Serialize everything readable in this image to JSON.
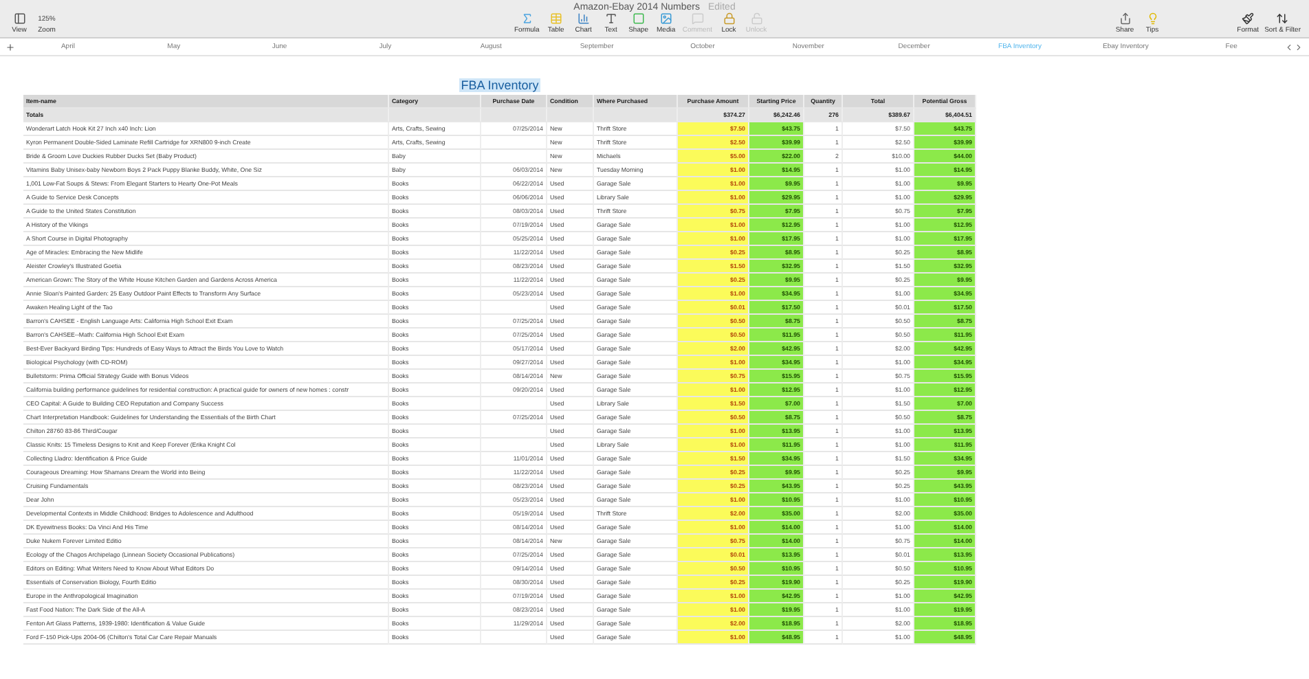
{
  "window": {
    "title": "Amazon-Ebay 2014 Numbers",
    "status": "Edited"
  },
  "toolbar": {
    "left": [
      {
        "label": "View",
        "kind": "view"
      },
      {
        "label": "Zoom",
        "kind": "zoom",
        "value": "125%"
      }
    ],
    "center": [
      {
        "label": "Formula",
        "kind": "formula",
        "disabled": false
      },
      {
        "label": "Table",
        "kind": "table",
        "disabled": false
      },
      {
        "label": "Chart",
        "kind": "chart",
        "disabled": false
      },
      {
        "label": "Text",
        "kind": "text",
        "disabled": false
      },
      {
        "label": "Shape",
        "kind": "shape",
        "disabled": false
      },
      {
        "label": "Media",
        "kind": "media",
        "disabled": false
      },
      {
        "label": "Comment",
        "kind": "comment",
        "disabled": true
      },
      {
        "label": "Lock",
        "kind": "lock",
        "disabled": false
      },
      {
        "label": "Unlock",
        "kind": "unlock",
        "disabled": true
      }
    ],
    "right": [
      {
        "label": "Share",
        "kind": "share",
        "disabled": false
      },
      {
        "label": "Tips",
        "kind": "tips",
        "disabled": false
      }
    ],
    "far_right": [
      {
        "label": "Format",
        "kind": "format",
        "disabled": false
      },
      {
        "label": "Sort & Filter",
        "kind": "sort",
        "disabled": false
      }
    ]
  },
  "sheet_tabs": [
    {
      "label": "April",
      "selected": false
    },
    {
      "label": "May",
      "selected": false
    },
    {
      "label": "June",
      "selected": false
    },
    {
      "label": "July",
      "selected": false
    },
    {
      "label": "August",
      "selected": false
    },
    {
      "label": "September",
      "selected": false
    },
    {
      "label": "October",
      "selected": false
    },
    {
      "label": "November",
      "selected": false
    },
    {
      "label": "December",
      "selected": false
    },
    {
      "label": "FBA Inventory",
      "selected": true
    },
    {
      "label": "Ebay Inventory",
      "selected": false
    },
    {
      "label": "Fee",
      "selected": false
    }
  ],
  "table": {
    "title": "FBA Inventory",
    "columns": [
      {
        "label": "Item-name",
        "kind": "text"
      },
      {
        "label": "Category",
        "kind": "text"
      },
      {
        "label": "Purchase Date",
        "kind": "date"
      },
      {
        "label": "Condition",
        "kind": "text"
      },
      {
        "label": "Where Purchased",
        "kind": "text"
      },
      {
        "label": "Purchase Amount",
        "kind": "cost"
      },
      {
        "label": "Starting Price",
        "kind": "price"
      },
      {
        "label": "Quantity",
        "kind": "number"
      },
      {
        "label": "Total",
        "kind": "number"
      },
      {
        "label": "Potential Gross",
        "kind": "price"
      }
    ],
    "totals": {
      "label": "Totals",
      "values": [
        "$374.27",
        "$6,242.46",
        "276",
        "$389.67",
        "$6,404.51"
      ]
    },
    "rows": [
      [
        "Wonderart Latch Hook Kit 27 Inch x40 Inch: Lion",
        "Arts, Crafts, Sewing",
        "07/25/2014",
        "New",
        "Thrift Store",
        "$7.50",
        "$43.75",
        "1",
        "$7.50",
        "$43.75"
      ],
      [
        "Kyron Permanent Double-Sided Laminate Refill Cartridge for XRN800 9-inch Create",
        "Arts, Crafts, Sewing",
        null,
        "New",
        "Thrift Store",
        "$2.50",
        "$39.99",
        "1",
        "$2.50",
        "$39.99"
      ],
      [
        "Bride & Groom Love Duckies Rubber Ducks Set (Baby Product)",
        "Baby",
        null,
        "New",
        "Michaels",
        "$5.00",
        "$22.00",
        "2",
        "$10.00",
        "$44.00"
      ],
      [
        "Vitamins Baby Unisex-baby Newborn Boys 2 Pack Puppy Blanke Buddy, White, One Siz",
        "Baby",
        "06/03/2014",
        "New",
        "Tuesday Morning",
        "$1.00",
        "$14.95",
        "1",
        "$1.00",
        "$14.95"
      ],
      [
        "1,001 Low-Fat Soups & Stews: From Elegant Starters to Hearty One-Pot Meals",
        "Books",
        "06/22/2014",
        "Used",
        "Garage Sale",
        "$1.00",
        "$9.95",
        "1",
        "$1.00",
        "$9.95"
      ],
      [
        "A Guide to Service Desk Concepts",
        "Books",
        "06/06/2014",
        "Used",
        "Library Sale",
        "$1.00",
        "$29.95",
        "1",
        "$1.00",
        "$29.95"
      ],
      [
        "A Guide to the United States Constitution",
        "Books",
        "08/03/2014",
        "Used",
        "Thrift Store",
        "$0.75",
        "$7.95",
        "1",
        "$0.75",
        "$7.95"
      ],
      [
        "A History of the Vikings",
        "Books",
        "07/19/2014",
        "Used",
        "Garage Sale",
        "$1.00",
        "$12.95",
        "1",
        "$1.00",
        "$12.95"
      ],
      [
        "A Short Course in Digital Photography",
        "Books",
        "05/25/2014",
        "Used",
        "Garage Sale",
        "$1.00",
        "$17.95",
        "1",
        "$1.00",
        "$17.95"
      ],
      [
        "Age of Miracles: Embracing the New Midlife",
        "Books",
        "11/22/2014",
        "Used",
        "Garage Sale",
        "$0.25",
        "$8.95",
        "1",
        "$0.25",
        "$8.95"
      ],
      [
        "Aleister Crowley's Illustrated Goetia",
        "Books",
        "08/23/2014",
        "Used",
        "Garage Sale",
        "$1.50",
        "$32.95",
        "1",
        "$1.50",
        "$32.95"
      ],
      [
        "American Grown: The Story of the White House Kitchen Garden and Gardens Across America",
        "Books",
        "11/22/2014",
        "Used",
        "Garage Sale",
        "$0.25",
        "$9.95",
        "1",
        "$0.25",
        "$9.95"
      ],
      [
        "Annie Sloan's Painted Garden: 25 Easy Outdoor Paint Effects to Transform Any Surface",
        "Books",
        "05/23/2014",
        "Used",
        "Garage Sale",
        "$1.00",
        "$34.95",
        "1",
        "$1.00",
        "$34.95"
      ],
      [
        "Awaken Healing Light of the Tao",
        "Books",
        null,
        "Used",
        "Garage Sale",
        "$0.01",
        "$17.50",
        "1",
        "$0.01",
        "$17.50"
      ],
      [
        "Barron's CAHSEE - English Language Arts: California High School Exit Exam",
        "Books",
        "07/25/2014",
        "Used",
        "Garage Sale",
        "$0.50",
        "$8.75",
        "1",
        "$0.50",
        "$8.75"
      ],
      [
        "Barron's CAHSEE--Math: California High School Exit Exam",
        "Books",
        "07/25/2014",
        "Used",
        "Garage Sale",
        "$0.50",
        "$11.95",
        "1",
        "$0.50",
        "$11.95"
      ],
      [
        "Best-Ever Backyard Birding Tips: Hundreds of Easy Ways to Attract the Birds You Love to Watch",
        "Books",
        "05/17/2014",
        "Used",
        "Garage Sale",
        "$2.00",
        "$42.95",
        "1",
        "$2.00",
        "$42.95"
      ],
      [
        "Biological Psychology (with CD-ROM)",
        "Books",
        "09/27/2014",
        "Used",
        "Garage Sale",
        "$1.00",
        "$34.95",
        "1",
        "$1.00",
        "$34.95"
      ],
      [
        "Bulletstorm: Prima Official Strategy Guide with Bonus Videos",
        "Books",
        "08/14/2014",
        "New",
        "Garage Sale",
        "$0.75",
        "$15.95",
        "1",
        "$0.75",
        "$15.95"
      ],
      [
        "California building performance guidelines for residential construction: A practical guide for owners of new homes : constr",
        "Books",
        "09/20/2014",
        "Used",
        "Garage Sale",
        "$1.00",
        "$12.95",
        "1",
        "$1.00",
        "$12.95"
      ],
      [
        "CEO Capital: A Guide to Building CEO Reputation and Company Success",
        "Books",
        null,
        "Used",
        "Library Sale",
        "$1.50",
        "$7.00",
        "1",
        "$1.50",
        "$7.00"
      ],
      [
        "Chart Interpretation Handbook: Guidelines for Understanding the Essentials of the Birth Chart",
        "Books",
        "07/25/2014",
        "Used",
        "Garage Sale",
        "$0.50",
        "$8.75",
        "1",
        "$0.50",
        "$8.75"
      ],
      [
        "Chilton 28760 83-86 Third/Cougar",
        "Books",
        null,
        "Used",
        "Garage Sale",
        "$1.00",
        "$13.95",
        "1",
        "$1.00",
        "$13.95"
      ],
      [
        "Classic Knits: 15 Timeless Designs to Knit and Keep Forever (Erika Knight Col",
        "Books",
        null,
        "Used",
        "Library Sale",
        "$1.00",
        "$11.95",
        "1",
        "$1.00",
        "$11.95"
      ],
      [
        "Collecting Lladro: Identification & Price Guide",
        "Books",
        "11/01/2014",
        "Used",
        "Garage Sale",
        "$1.50",
        "$34.95",
        "1",
        "$1.50",
        "$34.95"
      ],
      [
        "Courageous Dreaming: How Shamans Dream the World into Being",
        "Books",
        "11/22/2014",
        "Used",
        "Garage Sale",
        "$0.25",
        "$9.95",
        "1",
        "$0.25",
        "$9.95"
      ],
      [
        "Cruising Fundamentals",
        "Books",
        "08/23/2014",
        "Used",
        "Garage Sale",
        "$0.25",
        "$43.95",
        "1",
        "$0.25",
        "$43.95"
      ],
      [
        "Dear John",
        "Books",
        "05/23/2014",
        "Used",
        "Garage Sale",
        "$1.00",
        "$10.95",
        "1",
        "$1.00",
        "$10.95"
      ],
      [
        "Developmental Contexts in Middle Childhood: Bridges to Adolescence and Adulthood",
        "Books",
        "05/19/2014",
        "Used",
        "Thrift Store",
        "$2.00",
        "$35.00",
        "1",
        "$2.00",
        "$35.00"
      ],
      [
        "DK Eyewitness Books: Da Vinci And His Time",
        "Books",
        "08/14/2014",
        "Used",
        "Garage Sale",
        "$1.00",
        "$14.00",
        "1",
        "$1.00",
        "$14.00"
      ],
      [
        "Duke Nukem Forever Limited Editio",
        "Books",
        "08/14/2014",
        "New",
        "Garage Sale",
        "$0.75",
        "$14.00",
        "1",
        "$0.75",
        "$14.00"
      ],
      [
        "Ecology of the Chagos Archipelago (Linnean Society Occasional Publications)",
        "Books",
        "07/25/2014",
        "Used",
        "Garage Sale",
        "$0.01",
        "$13.95",
        "1",
        "$0.01",
        "$13.95"
      ],
      [
        "Editors on Editing: What Writers Need to Know About What Editors Do",
        "Books",
        "09/14/2014",
        "Used",
        "Garage Sale",
        "$0.50",
        "$10.95",
        "1",
        "$0.50",
        "$10.95"
      ],
      [
        "Essentials of Conservation Biology, Fourth Editio",
        "Books",
        "08/30/2014",
        "Used",
        "Garage Sale",
        "$0.25",
        "$19.90",
        "1",
        "$0.25",
        "$19.90"
      ],
      [
        "Europe in the Anthropological Imagination",
        "Books",
        "07/19/2014",
        "Used",
        "Garage Sale",
        "$1.00",
        "$42.95",
        "1",
        "$1.00",
        "$42.95"
      ],
      [
        "Fast Food Nation: The Dark Side of the All-A",
        "Books",
        "08/23/2014",
        "Used",
        "Garage Sale",
        "$1.00",
        "$19.95",
        "1",
        "$1.00",
        "$19.95"
      ],
      [
        "Fenton Art Glass Patterns, 1939-1980: Identification & Value Guide",
        "Books",
        "11/29/2014",
        "Used",
        "Garage Sale",
        "$2.00",
        "$18.95",
        "1",
        "$2.00",
        "$18.95"
      ],
      [
        "Ford F-150 Pick-Ups 2004-06 (Chilton's Total Car Care Repair Manuals",
        "Books",
        null,
        "Used",
        "Garage Sale",
        "$1.00",
        "$48.95",
        "1",
        "$1.00",
        "$48.95"
      ]
    ]
  }
}
